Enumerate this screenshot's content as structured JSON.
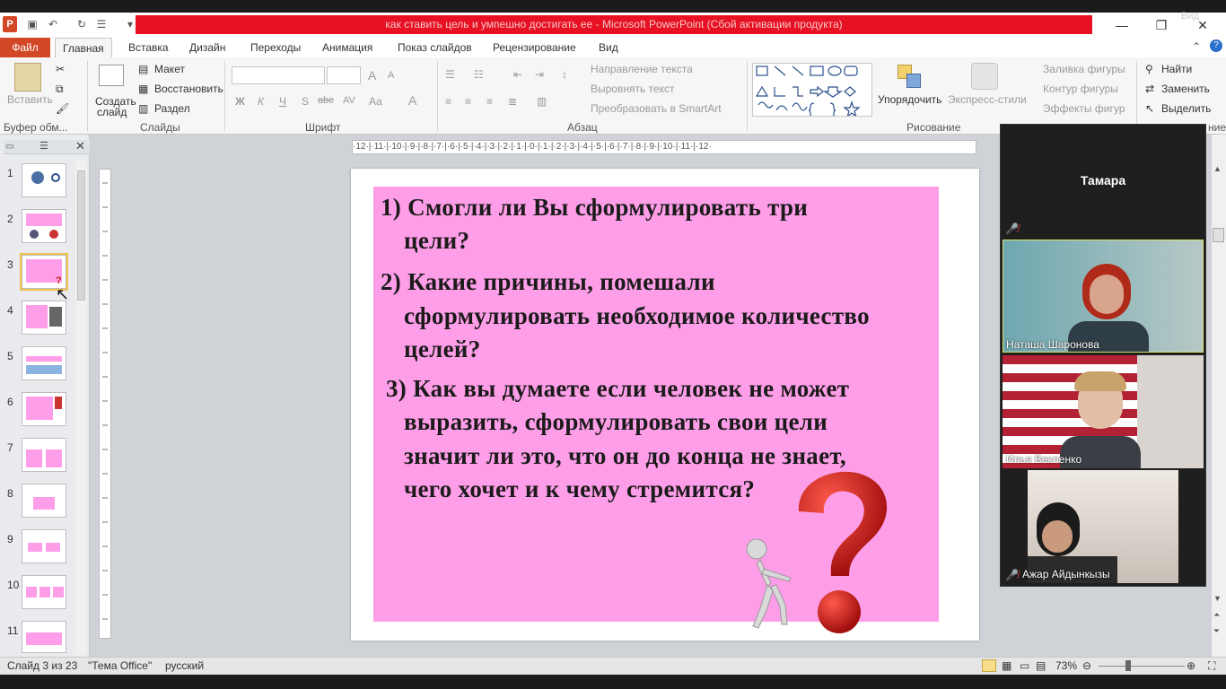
{
  "window": {
    "title": "как ставить цель и умпешно достигать ее  -  Microsoft PowerPoint (Сбой активации продукта)",
    "view_badge": "Вид"
  },
  "ribbon": {
    "tabs": [
      "Файл",
      "Главная",
      "Вставка",
      "Дизайн",
      "Переходы",
      "Анимация",
      "Показ слайдов",
      "Рецензирование",
      "Вид"
    ],
    "clipboard": {
      "paste": "Вставить",
      "label": "Буфер обм..."
    },
    "slides": {
      "new_slide_1": "Создать",
      "new_slide_2": "слайд",
      "layout": "Макет",
      "reset": "Восстановить",
      "section": "Раздел",
      "label": "Слайды"
    },
    "font": {
      "bold": "Ж",
      "italic": "К",
      "underline": "Ч",
      "strike": "abc",
      "shadow": "S",
      "spacing": "AV",
      "case": "Aa",
      "color": "A",
      "grow": "A",
      "shrink": "A",
      "label": "Шрифт"
    },
    "paragraph": {
      "text_direction": "Направление текста",
      "align_text": "Выровнять текст",
      "smartart": "Преобразовать в SmartArt",
      "label": "Абзац"
    },
    "drawing": {
      "arrange": "Упорядочить",
      "quick_styles": "Экспресс-стили",
      "shape_fill": "Заливка фигуры",
      "shape_outline": "Контур фигуры",
      "shape_effects": "Эффекты фигур",
      "label": "Рисование"
    },
    "editing": {
      "find": "Найти",
      "replace": "Заменить",
      "select": "Выделить",
      "label": "ние"
    }
  },
  "thumbnails": [
    1,
    2,
    3,
    4,
    5,
    6,
    7,
    8,
    9,
    10,
    11
  ],
  "active_slide": 3,
  "ruler": {
    "h_ticks": "·12·|·11·|·10·|·9·|·8·|·7·|·6·|·5·|·4·|·3·|·2·|·1·|·0·|·1·|·2·|·3·|·4·|·5·|·6·|·7·|·8·|·9·|·10·|·11·|·12·"
  },
  "slide": {
    "q1_line1": "1) Смогли ли Вы сформулировать три",
    "q1_line2": "цели?",
    "q2_line1": "2) Какие причины, помешали",
    "q2_line2": "сформулировать необходимое количество",
    "q2_line3": "целей?",
    "q3_line1": "3)  Как вы  думаете если человек не может",
    "q3_line2": "выразить, сформулировать свои цели",
    "q3_line3": "значит ли это, что он до конца не знает,",
    "q3_line4": "чего хочет и к чему стремится?",
    "pink_color": "#ff9ee8"
  },
  "video": {
    "host": "Тамара",
    "participants": [
      "Наташа Шаронова",
      "Илья Векленко",
      "Ажар Айдынкызы"
    ]
  },
  "status": {
    "slide_info": "Слайд 3 из 23",
    "theme": "\"Тема Office\"",
    "language": "русский",
    "zoom": "73%"
  }
}
